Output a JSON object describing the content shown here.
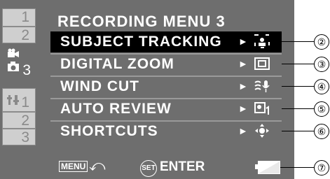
{
  "tabs": [
    {
      "label": "1",
      "icon": ""
    },
    {
      "label": "2",
      "icon": ""
    },
    {
      "label": "3",
      "icon": "camera-video-icon"
    },
    {
      "label": "1",
      "icon": "setup-icon"
    },
    {
      "label": "2",
      "icon": ""
    },
    {
      "label": "3",
      "icon": ""
    }
  ],
  "title": "RECORDING MENU 3",
  "items": [
    {
      "label": "SUBJECT TRACKING",
      "arrow": "►",
      "icon": "subject-tracking-icon",
      "glyph": "⌸",
      "selected": true
    },
    {
      "label": "DIGITAL ZOOM",
      "arrow": "►",
      "icon": "digital-zoom-icon",
      "glyph": "⊟",
      "selected": false
    },
    {
      "label": "WIND CUT",
      "arrow": "►",
      "icon": "wind-cut-icon",
      "glyph": "≋",
      "selected": false
    },
    {
      "label": "AUTO REVIEW",
      "arrow": "►",
      "icon": "auto-review-icon",
      "glyph": "▧",
      "selected": false
    },
    {
      "label": "SHORTCUTS",
      "arrow": "►",
      "icon": "shortcuts-icon",
      "glyph": "◈",
      "selected": false
    }
  ],
  "footer": {
    "menu_key": "MENU",
    "back_glyph": "⤺",
    "set_key": "SET",
    "enter_label": "ENTER"
  },
  "callouts": [
    "②",
    "③",
    "④",
    "⑤",
    "⑥",
    "⑦"
  ]
}
